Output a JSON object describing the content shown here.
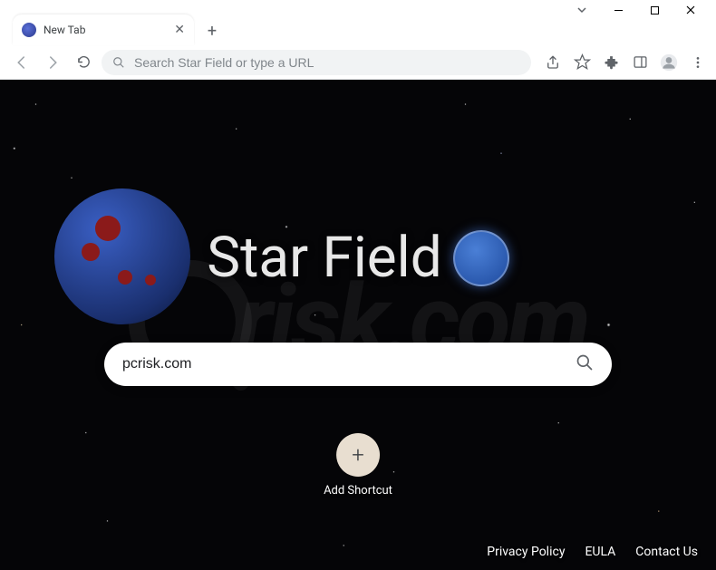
{
  "window": {
    "tab_title": "New Tab"
  },
  "omnibox": {
    "placeholder": "Search Star Field or type a URL"
  },
  "page": {
    "title": "Star Field",
    "search_value": "pcrisk.com",
    "shortcut_label": "Add Shortcut",
    "watermark_text": "risk.com"
  },
  "footer": {
    "links": [
      "Privacy Policy",
      "EULA",
      "Contact Us"
    ]
  },
  "icons": {
    "close": "✕",
    "plus": "+",
    "minus": "—"
  }
}
